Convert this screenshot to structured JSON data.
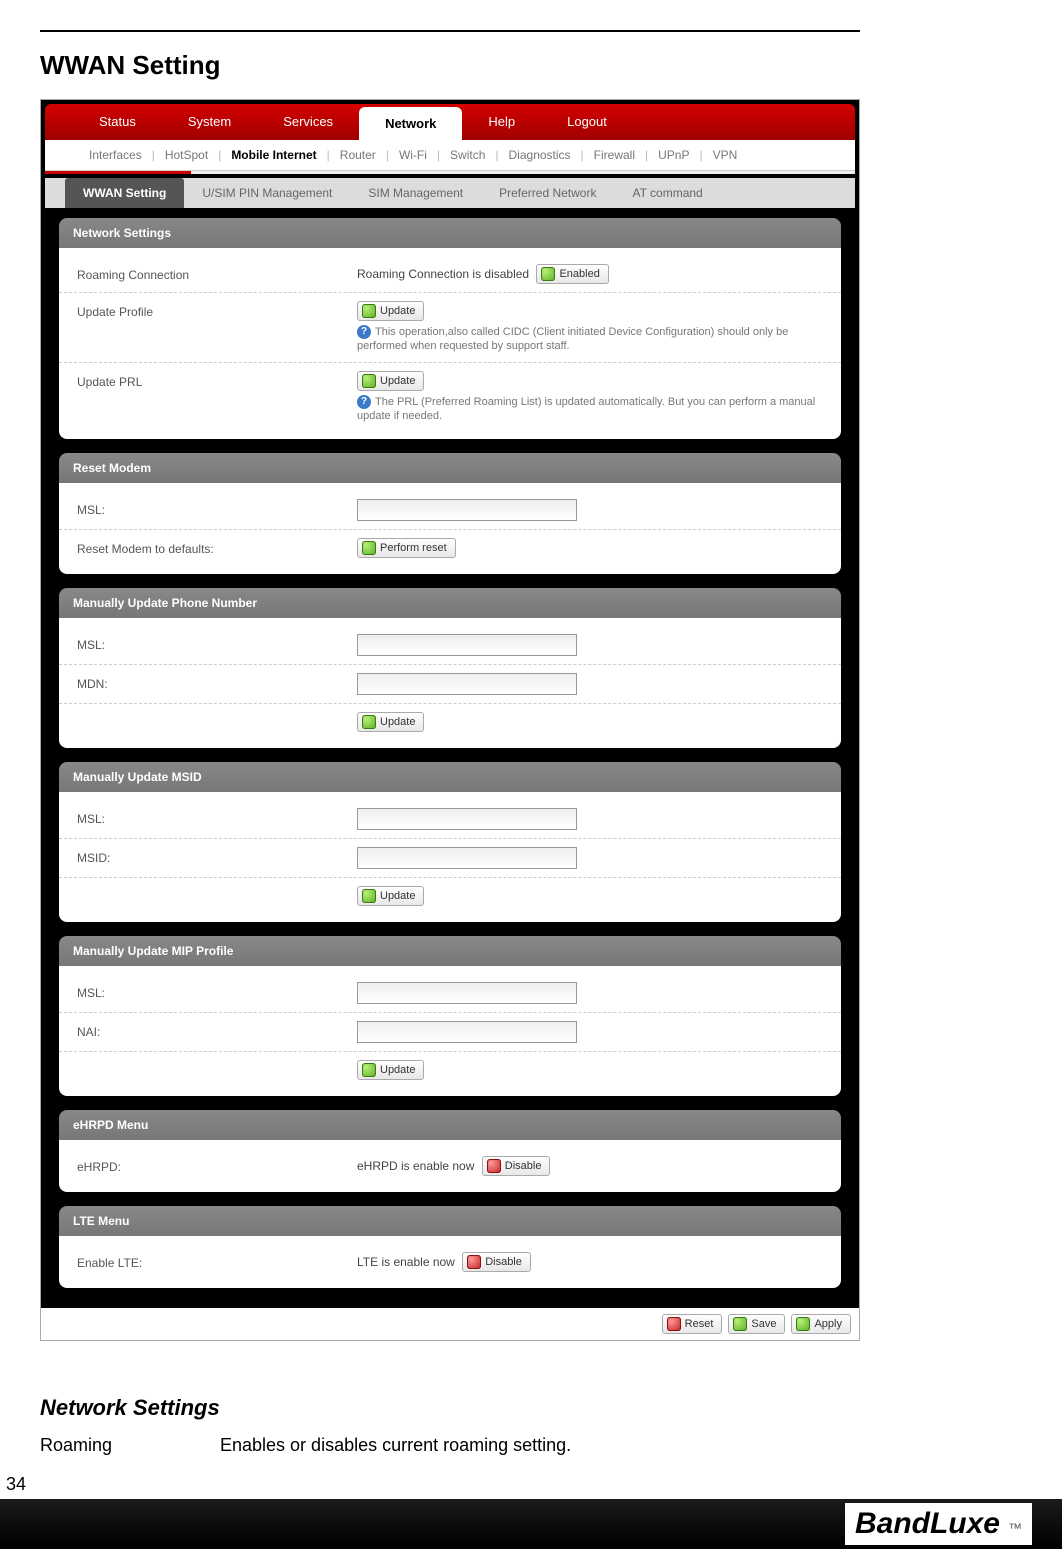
{
  "doc": {
    "page_title": "WWAN Setting",
    "section_heading": "Network Settings",
    "desc_label": "Roaming",
    "desc_text": "Enables or disables current roaming setting.",
    "page_number": "34",
    "brand": "BandLuxe",
    "tm": "™"
  },
  "nav": {
    "top": [
      "Status",
      "System",
      "Services",
      "Network",
      "Help",
      "Logout"
    ],
    "top_active": "Network",
    "sub": [
      "Interfaces",
      "HotSpot",
      "Mobile Internet",
      "Router",
      "Wi-Fi",
      "Switch",
      "Diagnostics",
      "Firewall",
      "UPnP",
      "VPN"
    ],
    "sub_active": "Mobile Internet",
    "ter": [
      "WWAN Setting",
      "U/SIM PIN Management",
      "SIM Management",
      "Preferred Network",
      "AT command"
    ],
    "ter_active": "WWAN Setting"
  },
  "panels": {
    "network_settings": {
      "title": "Network Settings",
      "roaming_label": "Roaming Connection",
      "roaming_status": "Roaming Connection is disabled",
      "roaming_btn": "Enabled",
      "update_profile_label": "Update Profile",
      "update_profile_btn": "Update",
      "update_profile_help": "This operation,also called CIDC (Client initiated Device Configuration) should only be performed when requested by support staff.",
      "update_prl_label": "Update PRL",
      "update_prl_btn": "Update",
      "update_prl_help": "The PRL (Preferred Roaming List) is updated automatically. But you can perform a manual update if needed."
    },
    "reset_modem": {
      "title": "Reset Modem",
      "msl_label": "MSL:",
      "reset_label": "Reset Modem to defaults:",
      "reset_btn": "Perform reset"
    },
    "update_phone": {
      "title": "Manually Update Phone Number",
      "msl_label": "MSL:",
      "mdn_label": "MDN:",
      "update_btn": "Update"
    },
    "update_msid": {
      "title": "Manually Update MSID",
      "msl_label": "MSL:",
      "msid_label": "MSID:",
      "update_btn": "Update"
    },
    "update_mip": {
      "title": "Manually Update MIP Profile",
      "msl_label": "MSL:",
      "nai_label": "NAI:",
      "update_btn": "Update"
    },
    "ehrpd": {
      "title": "eHRPD Menu",
      "label": "eHRPD:",
      "status": "eHRPD is enable now",
      "btn": "Disable"
    },
    "lte": {
      "title": "LTE Menu",
      "label": "Enable LTE:",
      "status": "LTE is enable now",
      "btn": "Disable"
    }
  },
  "footer_buttons": {
    "reset": "Reset",
    "save": "Save",
    "apply": "Apply"
  }
}
